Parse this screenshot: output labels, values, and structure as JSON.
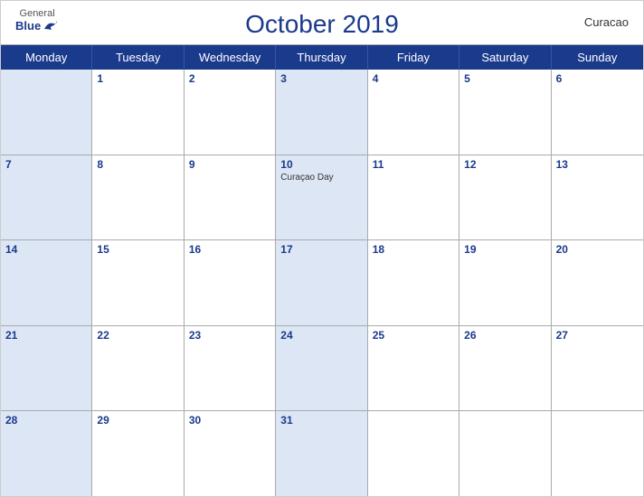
{
  "header": {
    "logo": {
      "general": "General",
      "blue": "Blue"
    },
    "title": "October 2019",
    "country": "Curacao"
  },
  "days_of_week": [
    "Monday",
    "Tuesday",
    "Wednesday",
    "Thursday",
    "Friday",
    "Saturday",
    "Sunday"
  ],
  "weeks": [
    [
      {
        "date": "",
        "empty": true,
        "blue": true
      },
      {
        "date": "1",
        "empty": false,
        "blue": false
      },
      {
        "date": "2",
        "empty": false,
        "blue": false
      },
      {
        "date": "3",
        "empty": false,
        "blue": true
      },
      {
        "date": "4",
        "empty": false,
        "blue": false
      },
      {
        "date": "5",
        "empty": false,
        "blue": false
      },
      {
        "date": "6",
        "empty": false,
        "blue": false
      }
    ],
    [
      {
        "date": "7",
        "empty": false,
        "blue": true
      },
      {
        "date": "8",
        "empty": false,
        "blue": false
      },
      {
        "date": "9",
        "empty": false,
        "blue": false
      },
      {
        "date": "10",
        "empty": false,
        "blue": true,
        "event": "Curaçao Day"
      },
      {
        "date": "11",
        "empty": false,
        "blue": false
      },
      {
        "date": "12",
        "empty": false,
        "blue": false
      },
      {
        "date": "13",
        "empty": false,
        "blue": false
      }
    ],
    [
      {
        "date": "14",
        "empty": false,
        "blue": true
      },
      {
        "date": "15",
        "empty": false,
        "blue": false
      },
      {
        "date": "16",
        "empty": false,
        "blue": false
      },
      {
        "date": "17",
        "empty": false,
        "blue": true
      },
      {
        "date": "18",
        "empty": false,
        "blue": false
      },
      {
        "date": "19",
        "empty": false,
        "blue": false
      },
      {
        "date": "20",
        "empty": false,
        "blue": false
      }
    ],
    [
      {
        "date": "21",
        "empty": false,
        "blue": true
      },
      {
        "date": "22",
        "empty": false,
        "blue": false
      },
      {
        "date": "23",
        "empty": false,
        "blue": false
      },
      {
        "date": "24",
        "empty": false,
        "blue": true
      },
      {
        "date": "25",
        "empty": false,
        "blue": false
      },
      {
        "date": "26",
        "empty": false,
        "blue": false
      },
      {
        "date": "27",
        "empty": false,
        "blue": false
      }
    ],
    [
      {
        "date": "28",
        "empty": false,
        "blue": true
      },
      {
        "date": "29",
        "empty": false,
        "blue": false
      },
      {
        "date": "30",
        "empty": false,
        "blue": false
      },
      {
        "date": "31",
        "empty": false,
        "blue": true
      },
      {
        "date": "",
        "empty": true,
        "blue": false
      },
      {
        "date": "",
        "empty": true,
        "blue": false
      },
      {
        "date": "",
        "empty": true,
        "blue": false
      }
    ]
  ]
}
